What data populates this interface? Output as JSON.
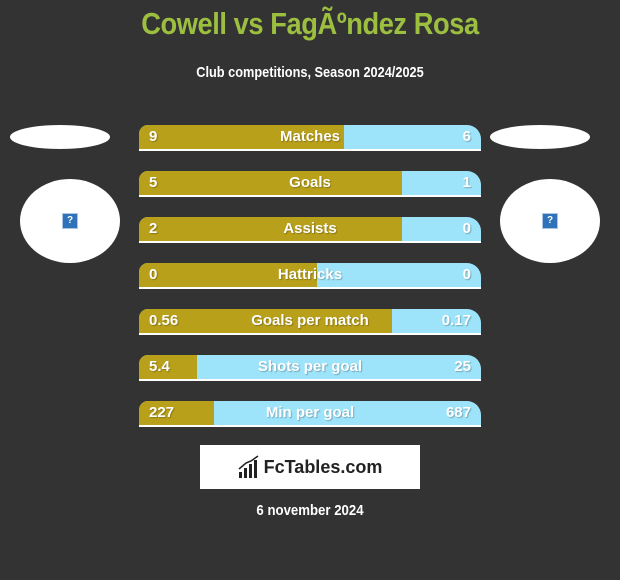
{
  "header": {
    "title": "Cowell vs FagÃºndez Rosa",
    "subtitle": "Club competitions, Season 2024/2025"
  },
  "players": {
    "left": {
      "logo_icon": "broken-image-icon",
      "logo_glyph": "?"
    },
    "right": {
      "logo_icon": "broken-image-icon",
      "logo_glyph": "?"
    }
  },
  "colors": {
    "title": "#9cbf40",
    "left_bar": "#b9a01a",
    "right_bar": "#9de3fa",
    "background": "#333333"
  },
  "stats": [
    {
      "label": "Matches",
      "left": "9",
      "right": "6",
      "left_share": 0.6
    },
    {
      "label": "Goals",
      "left": "5",
      "right": "1",
      "left_share": 0.77
    },
    {
      "label": "Assists",
      "left": "2",
      "right": "0",
      "left_share": 0.77
    },
    {
      "label": "Hattricks",
      "left": "0",
      "right": "0",
      "left_share": 0.52
    },
    {
      "label": "Goals per match",
      "left": "0.56",
      "right": "0.17",
      "left_share": 0.74
    },
    {
      "label": "Shots per goal",
      "left": "5.4",
      "right": "25",
      "left_share": 0.17
    },
    {
      "label": "Min per goal",
      "left": "227",
      "right": "687",
      "left_share": 0.22
    }
  ],
  "brand": {
    "name": "FcTables.com",
    "icon": "bar-chart-icon"
  },
  "footer": {
    "date": "6 november 2024"
  }
}
